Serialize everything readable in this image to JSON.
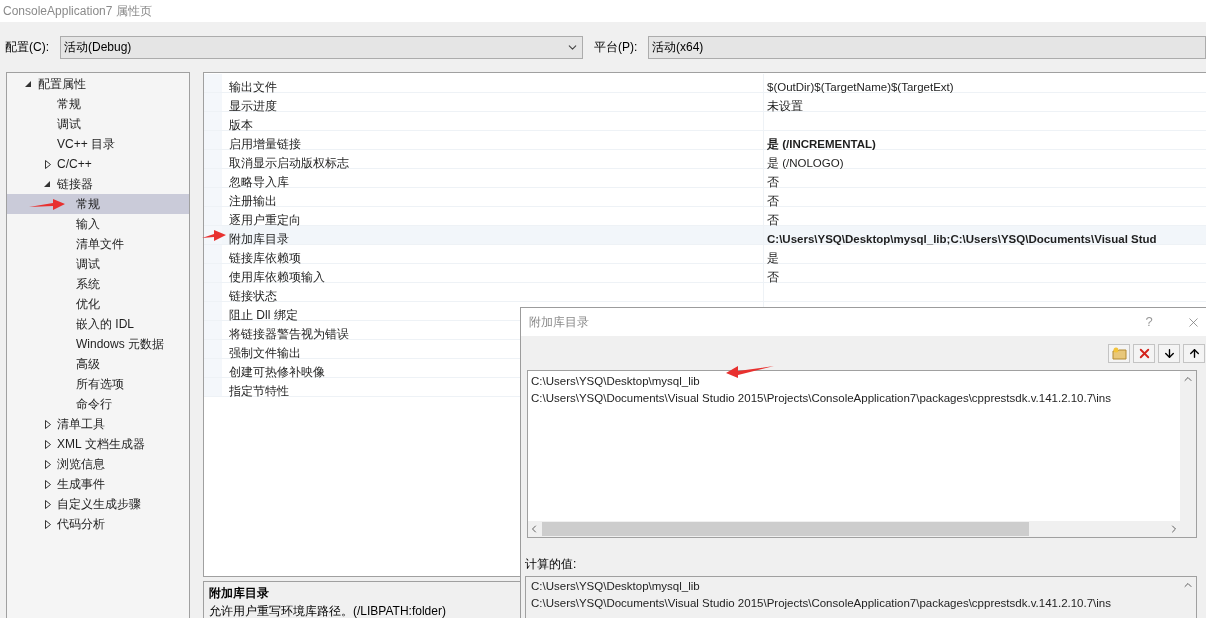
{
  "window": {
    "title": "ConsoleApplication7 属性页"
  },
  "configuration": {
    "label": "配置(C):",
    "value": "活动(Debug)"
  },
  "platform": {
    "label": "平台(P):",
    "value": "活动(x64)"
  },
  "tree": [
    {
      "label": "配置属性",
      "expanded": true,
      "selected": false,
      "children": [
        {
          "label": "常规",
          "selected": false
        },
        {
          "label": "调试",
          "selected": false
        },
        {
          "label": "VC++ 目录",
          "selected": false
        },
        {
          "label": "C/C++",
          "expanded": false,
          "selected": false
        },
        {
          "label": "链接器",
          "expanded": true,
          "selected": false,
          "children": [
            {
              "label": "常规",
              "selected": true
            },
            {
              "label": "输入",
              "selected": false
            },
            {
              "label": "清单文件",
              "selected": false
            },
            {
              "label": "调试",
              "selected": false
            },
            {
              "label": "系统",
              "selected": false
            },
            {
              "label": "优化",
              "selected": false
            },
            {
              "label": "嵌入的 IDL",
              "selected": false
            },
            {
              "label": "Windows 元数据",
              "selected": false
            },
            {
              "label": "高级",
              "selected": false
            },
            {
              "label": "所有选项",
              "selected": false
            },
            {
              "label": "命令行",
              "selected": false
            }
          ]
        },
        {
          "label": "清单工具",
          "expanded": false,
          "selected": false
        },
        {
          "label": "XML 文档生成器",
          "expanded": false,
          "selected": false
        },
        {
          "label": "浏览信息",
          "expanded": false,
          "selected": false
        },
        {
          "label": "生成事件",
          "expanded": false,
          "selected": false
        },
        {
          "label": "自定义生成步骤",
          "expanded": false,
          "selected": false
        },
        {
          "label": "代码分析",
          "expanded": false,
          "selected": false
        }
      ]
    }
  ],
  "properties": [
    {
      "name": "输出文件",
      "value": "$(OutDir)$(TargetName)$(TargetExt)",
      "bold": false,
      "selected": false
    },
    {
      "name": "显示进度",
      "value": "未设置",
      "bold": false,
      "selected": false
    },
    {
      "name": "版本",
      "selected": false
    },
    {
      "name": "启用增量链接",
      "value": "是 (/INCREMENTAL)",
      "bold": true,
      "selected": false
    },
    {
      "name": "取消显示启动版权标志",
      "value": "是 (/NOLOGO)",
      "bold": false,
      "selected": false
    },
    {
      "name": "忽略导入库",
      "value": "否",
      "bold": false,
      "selected": false
    },
    {
      "name": "注册输出",
      "value": "否",
      "bold": false,
      "selected": false
    },
    {
      "name": "逐用户重定向",
      "value": "否",
      "bold": false,
      "selected": false
    },
    {
      "name": "附加库目录",
      "value": "C:\\Users\\YSQ\\Desktop\\mysql_lib;C:\\Users\\YSQ\\Documents\\Visual Stud",
      "bold": true,
      "selected": true
    },
    {
      "name": "链接库依赖项",
      "value": "是",
      "bold": false,
      "selected": false
    },
    {
      "name": "使用库依赖项输入",
      "value": "否",
      "bold": false,
      "selected": false
    },
    {
      "name": "链接状态",
      "selected": false
    },
    {
      "name": "阻止 Dll 绑定",
      "selected": false
    },
    {
      "name": "将链接器警告视为错误",
      "selected": false
    },
    {
      "name": "强制文件输出",
      "selected": false
    },
    {
      "name": "创建可热修补映像",
      "selected": false
    },
    {
      "name": "指定节特性",
      "selected": false
    }
  ],
  "description": {
    "title": "附加库目录",
    "text": "允许用户重写环境库路径。(/LIBPATH:folder)"
  },
  "dialog": {
    "title": "附加库目录",
    "help": "?",
    "entries": [
      "C:\\Users\\YSQ\\Desktop\\mysql_lib",
      "C:\\Users\\YSQ\\Documents\\Visual Studio 2015\\Projects\\ConsoleApplication7\\packages\\cpprestsdk.v.141.2.10.7\\ins"
    ],
    "computed_label": "计算的值:",
    "computed": [
      "C:\\Users\\YSQ\\Desktop\\mysql_lib",
      "C:\\Users\\YSQ\\Documents\\Visual Studio 2015\\Projects\\ConsoleApplication7\\packages\\cpprestsdk.v.141.2.10.7\\ins"
    ]
  }
}
